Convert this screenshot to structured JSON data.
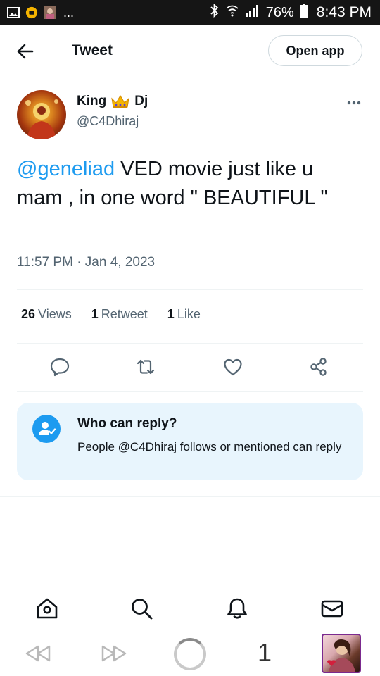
{
  "status_bar": {
    "battery_percent": "76%",
    "time": "8:43 PM",
    "overflow_dots": "..."
  },
  "header": {
    "title": "Tweet",
    "open_app_label": "Open app"
  },
  "author": {
    "name": "King",
    "name_suffix": "Dj",
    "handle": "@C4Dhiraj",
    "name_emoji": "crown-icon"
  },
  "tweet": {
    "mention": "@geneliad",
    "text": " VED movie just like u mam , in one word \" BEAUTIFUL \"",
    "timestamp": "11:57 PM · Jan 4, 2023"
  },
  "stats": {
    "views_count": "26",
    "views_label": "Views",
    "retweets_count": "1",
    "retweets_label": "Retweet",
    "likes_count": "1",
    "likes_label": "Like"
  },
  "reply_settings": {
    "title": "Who can reply?",
    "text": "People @C4Dhiraj follows or mentioned can reply"
  },
  "tabs": [
    "home-icon",
    "search-icon",
    "notifications-icon",
    "messages-icon"
  ],
  "system_bar": {
    "tab_count": "1"
  },
  "colors": {
    "accent": "#1d9bf0",
    "text_primary": "#0f1419",
    "text_secondary": "#536471",
    "reply_box_bg": "#e8f5fd"
  }
}
